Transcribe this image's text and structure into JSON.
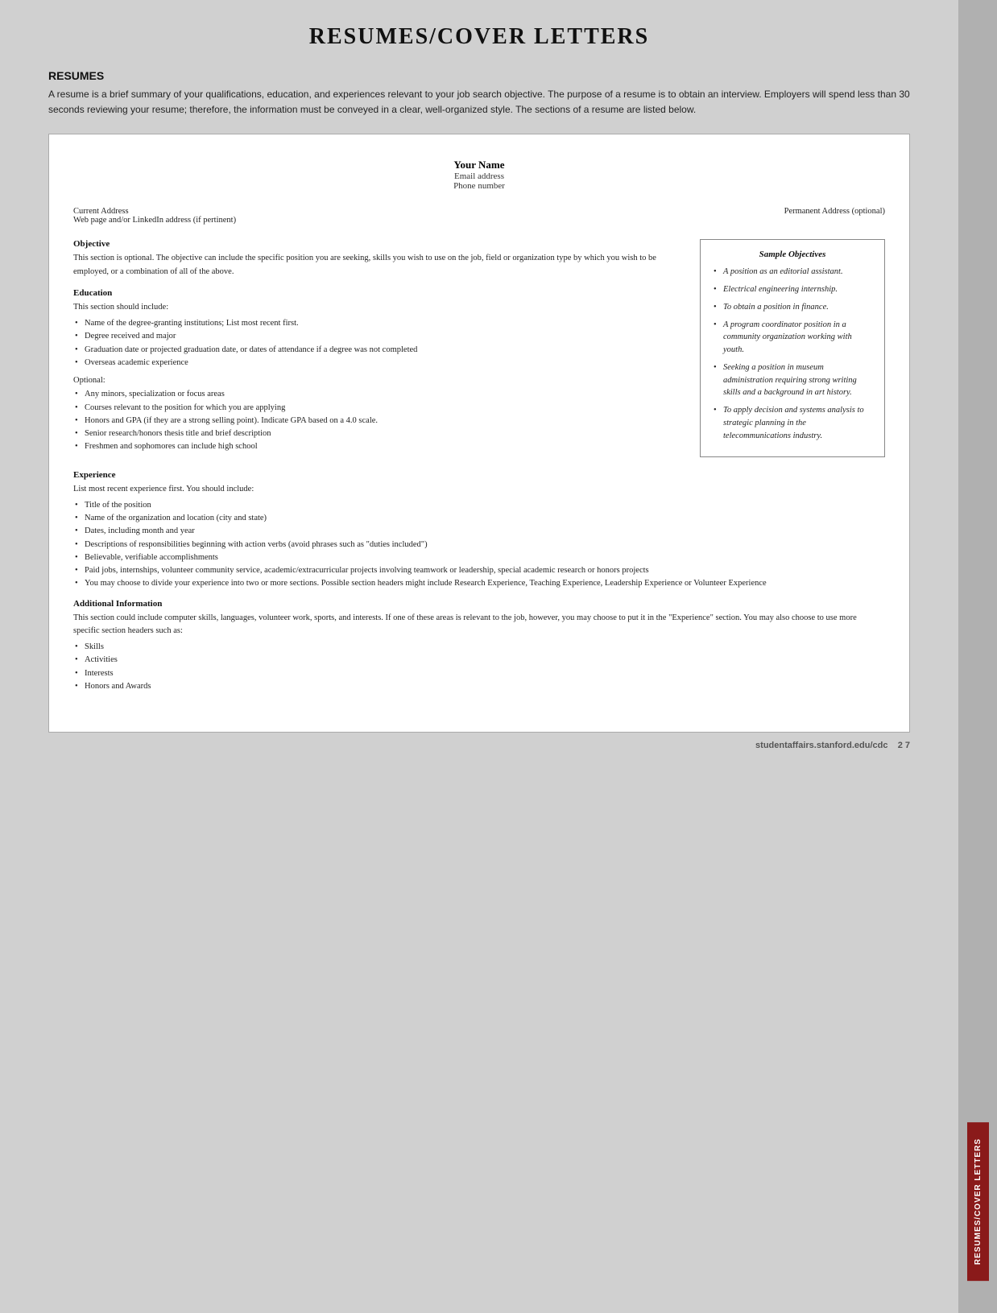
{
  "page": {
    "main_title": "RESUMES/COVER LETTERS",
    "resumes_heading": "RESUMES",
    "intro_paragraph": "A resume is a brief summary of your qualifications, education, and experiences relevant to your job search objective. The purpose of a resume is to obtain an interview. Employers will spend less than 30 seconds reviewing your resume; therefore, the information must be conveyed in a clear, well-organized style. The sections of a resume are listed below."
  },
  "document": {
    "your_name": "Your Name",
    "email": "Email address",
    "phone": "Phone number",
    "current_address": "Current Address",
    "web_address": "Web page and/or LinkedIn address (if pertinent)",
    "permanent_address": "Permanent Address (optional)",
    "objective_title": "Objective",
    "objective_text": "This section is optional. The objective can include the specific position you are seeking, skills you wish to use on the job, field or organization type by which you wish to be employed, or a combination of all of the above.",
    "education_title": "Education",
    "education_intro": "This section should include:",
    "education_bullets": [
      "Name of the degree-granting institutions; List most recent first.",
      "Degree received and major",
      "Graduation date or projected graduation date, or dates of attendance if a degree was not completed",
      "Overseas academic experience"
    ],
    "optional_label": "Optional:",
    "optional_bullets": [
      "Any minors, specialization or focus areas",
      "Courses relevant to the position for which you are applying",
      "Honors and GPA (if they are a strong selling point). Indicate GPA based on a 4.0 scale.",
      "Senior research/honors thesis title and brief description",
      "Freshmen and sophomores can include high school"
    ],
    "experience_title": "Experience",
    "experience_intro": "List most recent experience first. You should include:",
    "experience_bullets": [
      "Title of the position",
      "Name of the organization and location (city and state)",
      "Dates, including month and year",
      "Descriptions of responsibilities beginning with action verbs (avoid phrases such as \"duties included\")",
      "Believable, verifiable accomplishments",
      "Paid jobs, internships, volunteer community service, academic/extracurricular projects involving teamwork or leadership, special academic research or honors projects",
      "You may choose to divide your experience into two or more sections. Possible section headers might include Research Experience, Teaching Experience, Leadership Experience or Volunteer Experience"
    ],
    "additional_title": "Additional Information",
    "additional_text": "This section could include computer skills, languages, volunteer work, sports, and interests. If one of these areas is relevant to the job, however, you may choose to put it in the \"Experience\" section. You may also choose to use more specific section headers such as:",
    "additional_bullets": [
      "Skills",
      "Activities",
      "Interests",
      "Honors and Awards"
    ]
  },
  "sample_objectives": {
    "title": "Sample Objectives",
    "items": [
      "A position as an editorial assistant.",
      "Electrical engineering internship.",
      "To obtain a position in finance.",
      "A program coordinator position in a community organization working with youth.",
      "Seeking a position in museum administration requiring strong writing skills and a background in art history.",
      "To apply decision and systems analysis to strategic planning in the telecommunications industry."
    ]
  },
  "footer": {
    "url": "studentaffairs.stanford.edu/cdc",
    "page": "2 7"
  },
  "sidebar": {
    "tab_label": "RESUMES/COVER LETTERS"
  }
}
